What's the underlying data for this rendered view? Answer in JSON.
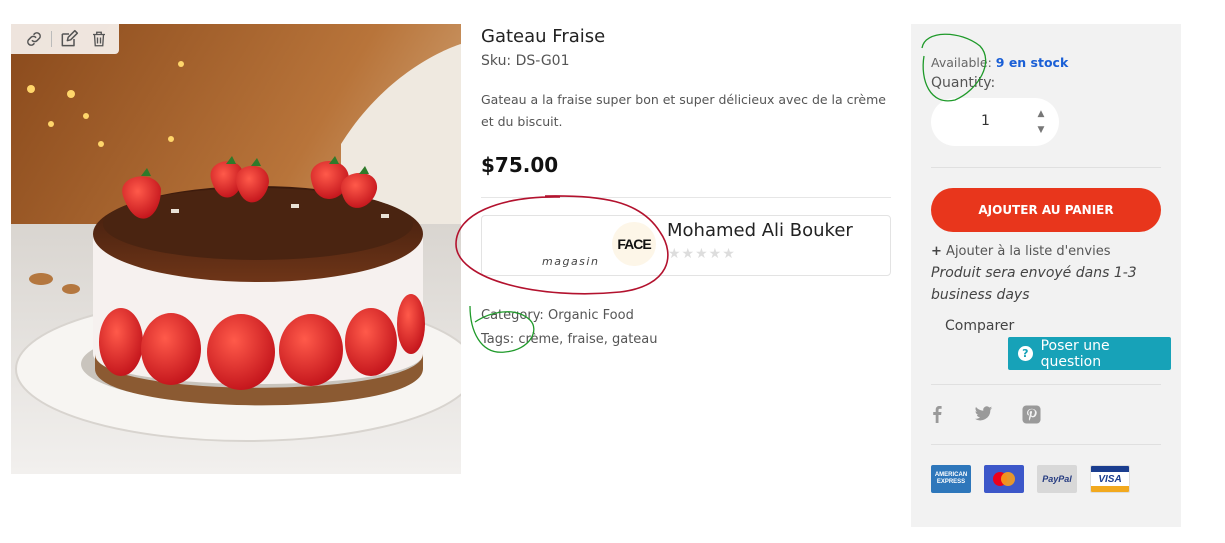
{
  "image_tools": {
    "link_icon": "link-icon",
    "edit_icon": "edit-icon",
    "delete_icon": "trash-icon"
  },
  "product": {
    "title": "Gateau Fraise",
    "sku": "Sku: DS-G01",
    "description": "Gateau a la fraise super bon et super délicieux avec de la crème et du biscuit.",
    "price": "$75.00"
  },
  "vendor": {
    "subtitle": "magasin",
    "logo_text": "FACE",
    "name": "Mohamed Ali Bouker",
    "rating": "★★★★★"
  },
  "meta": {
    "category_label": "Category:",
    "category_value": "Organic Food",
    "tags_label": "Tags:",
    "tags_value": "crème, fraise, gateau"
  },
  "panel": {
    "available_label": "Available:",
    "available_value": "9 en stock",
    "quantity_label": "Quantity:",
    "quantity_value": "1",
    "add_to_cart": "AJOUTER AU PANIER",
    "wishlist": "Ajouter à la liste d'envies",
    "shipping": "Produit sera envoyé dans 1-3 business days",
    "compare": "Comparer",
    "ask_question": "Poser une question",
    "social": [
      "facebook-icon",
      "twitter-icon",
      "pinterest-icon"
    ],
    "payments": {
      "amex": "AMERICAN EXPRESS",
      "paypal": "PayPal",
      "visa": "VISA"
    }
  },
  "colors": {
    "accent_red": "#e8361c",
    "info_teal": "#17a2b8",
    "stock_blue": "#1a5fd6",
    "panel_bg": "#f2f2f2",
    "annotation_red": "#b3122e",
    "annotation_green": "#1f9a2a"
  }
}
